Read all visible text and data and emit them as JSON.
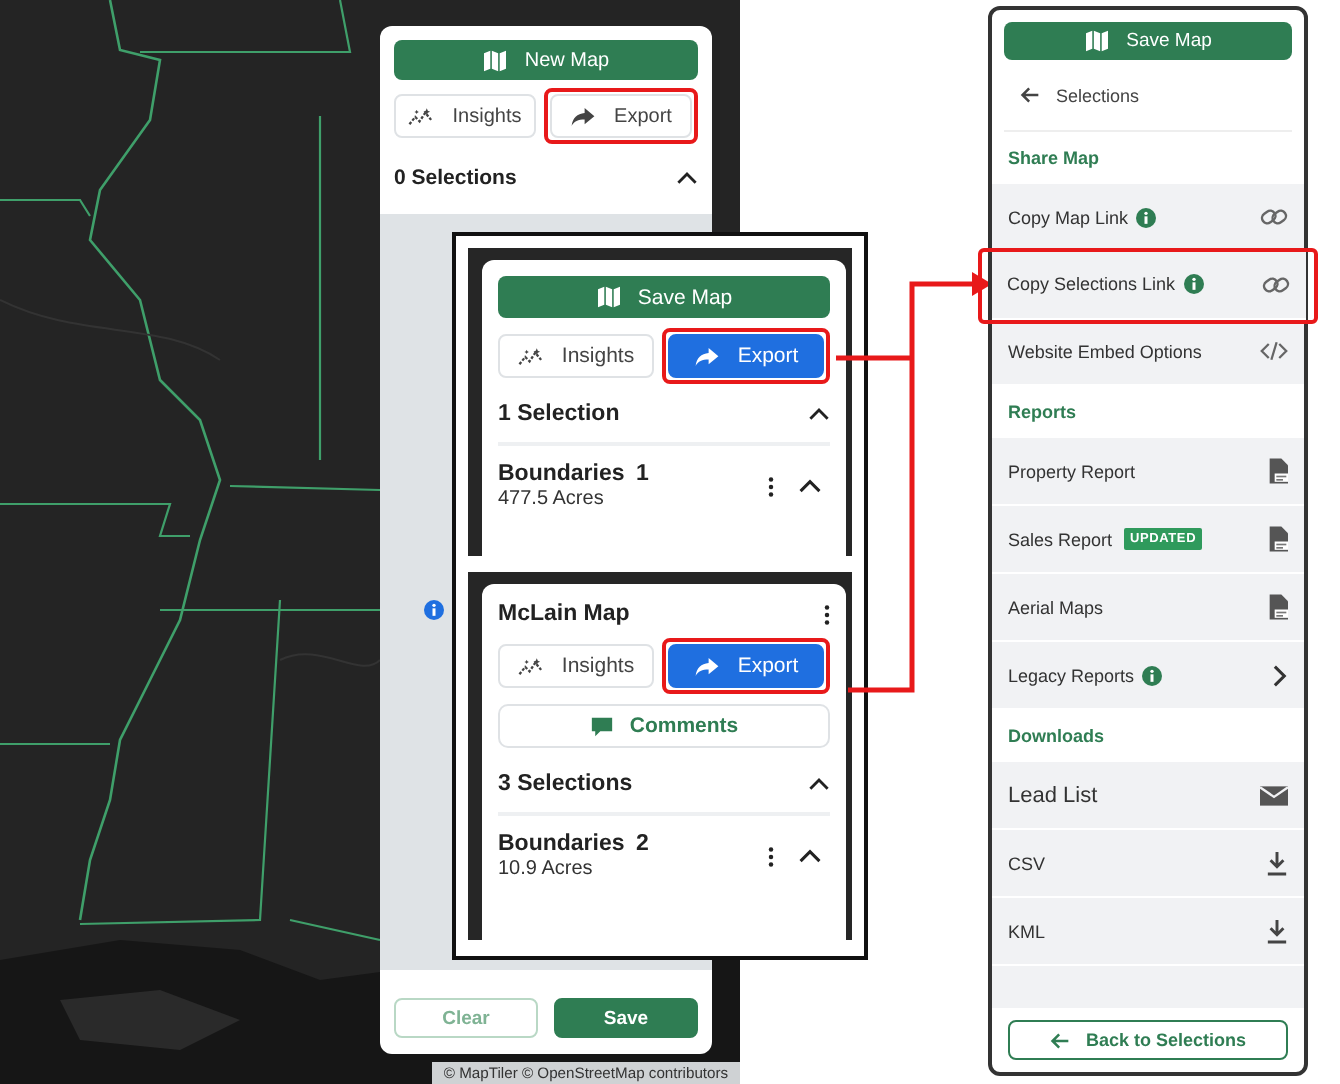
{
  "map": {
    "attribution": "© MapTiler © OpenStreetMap contributors"
  },
  "panel": {
    "top_button": "New Map",
    "buttons": [
      {
        "label": "Insights",
        "kind": "insights",
        "primary": false,
        "highlighted": false
      },
      {
        "label": "Export",
        "kind": "export",
        "primary": false,
        "highlighted": true
      }
    ],
    "section": {
      "label": "0 Selections",
      "expanded": true
    },
    "footer_buttons": [
      {
        "label": "Clear",
        "disabled": true
      },
      {
        "label": "Save",
        "disabled": false
      }
    ]
  },
  "insets": [
    {
      "top_button": "Save Map",
      "buttons": [
        {
          "label": "Insights",
          "kind": "insights",
          "primary": false,
          "highlighted": false
        },
        {
          "label": "Export",
          "kind": "export",
          "primary": true,
          "highlighted": true
        }
      ],
      "section": {
        "label": "1 Selection",
        "expanded": true
      },
      "items": [
        {
          "title": "Boundaries",
          "count": "1",
          "area": "477.5 Acres",
          "expanded": true
        }
      ]
    },
    {
      "title": "McLain Map",
      "buttons": [
        {
          "label": "Insights",
          "kind": "insights",
          "primary": false,
          "highlighted": false
        },
        {
          "label": "Export",
          "kind": "export",
          "primary": true,
          "highlighted": true
        }
      ],
      "comments": "Comments",
      "section": {
        "label": "3 Selections",
        "expanded": true
      },
      "items": [
        {
          "title": "Boundaries",
          "count": "2",
          "area": "10.9 Acres",
          "expanded": true
        }
      ]
    }
  ],
  "export_menu": {
    "top_button": "Save Map",
    "back": "Selections",
    "rows": [
      {
        "kind": "header",
        "label": "Share Map"
      },
      {
        "kind": "link",
        "label": "Copy Map Link",
        "info": true,
        "highlighted": false
      },
      {
        "kind": "link",
        "label": "Copy Selections Link",
        "info": true,
        "highlighted": true
      },
      {
        "kind": "embed",
        "label": "Website Embed Options",
        "info": false,
        "highlighted": false
      },
      {
        "kind": "header",
        "label": "Reports"
      },
      {
        "kind": "pdf",
        "label": "Property Report",
        "info": false,
        "highlighted": false
      },
      {
        "kind": "pdf",
        "label": "Sales Report",
        "badge": "UPDATED",
        "info": false,
        "highlighted": false
      },
      {
        "kind": "pdf",
        "label": "Aerial Maps",
        "info": false,
        "highlighted": false
      },
      {
        "kind": "submenu",
        "label": "Legacy Reports",
        "info": true,
        "highlighted": false
      },
      {
        "kind": "header",
        "label": "Downloads"
      },
      {
        "kind": "email",
        "label": "Lead List",
        "info": false,
        "highlighted": false
      },
      {
        "kind": "download",
        "label": "CSV",
        "info": false,
        "highlighted": false
      },
      {
        "kind": "download",
        "label": "KML",
        "info": false,
        "highlighted": false
      }
    ],
    "footer_button": "Back to Selections"
  }
}
